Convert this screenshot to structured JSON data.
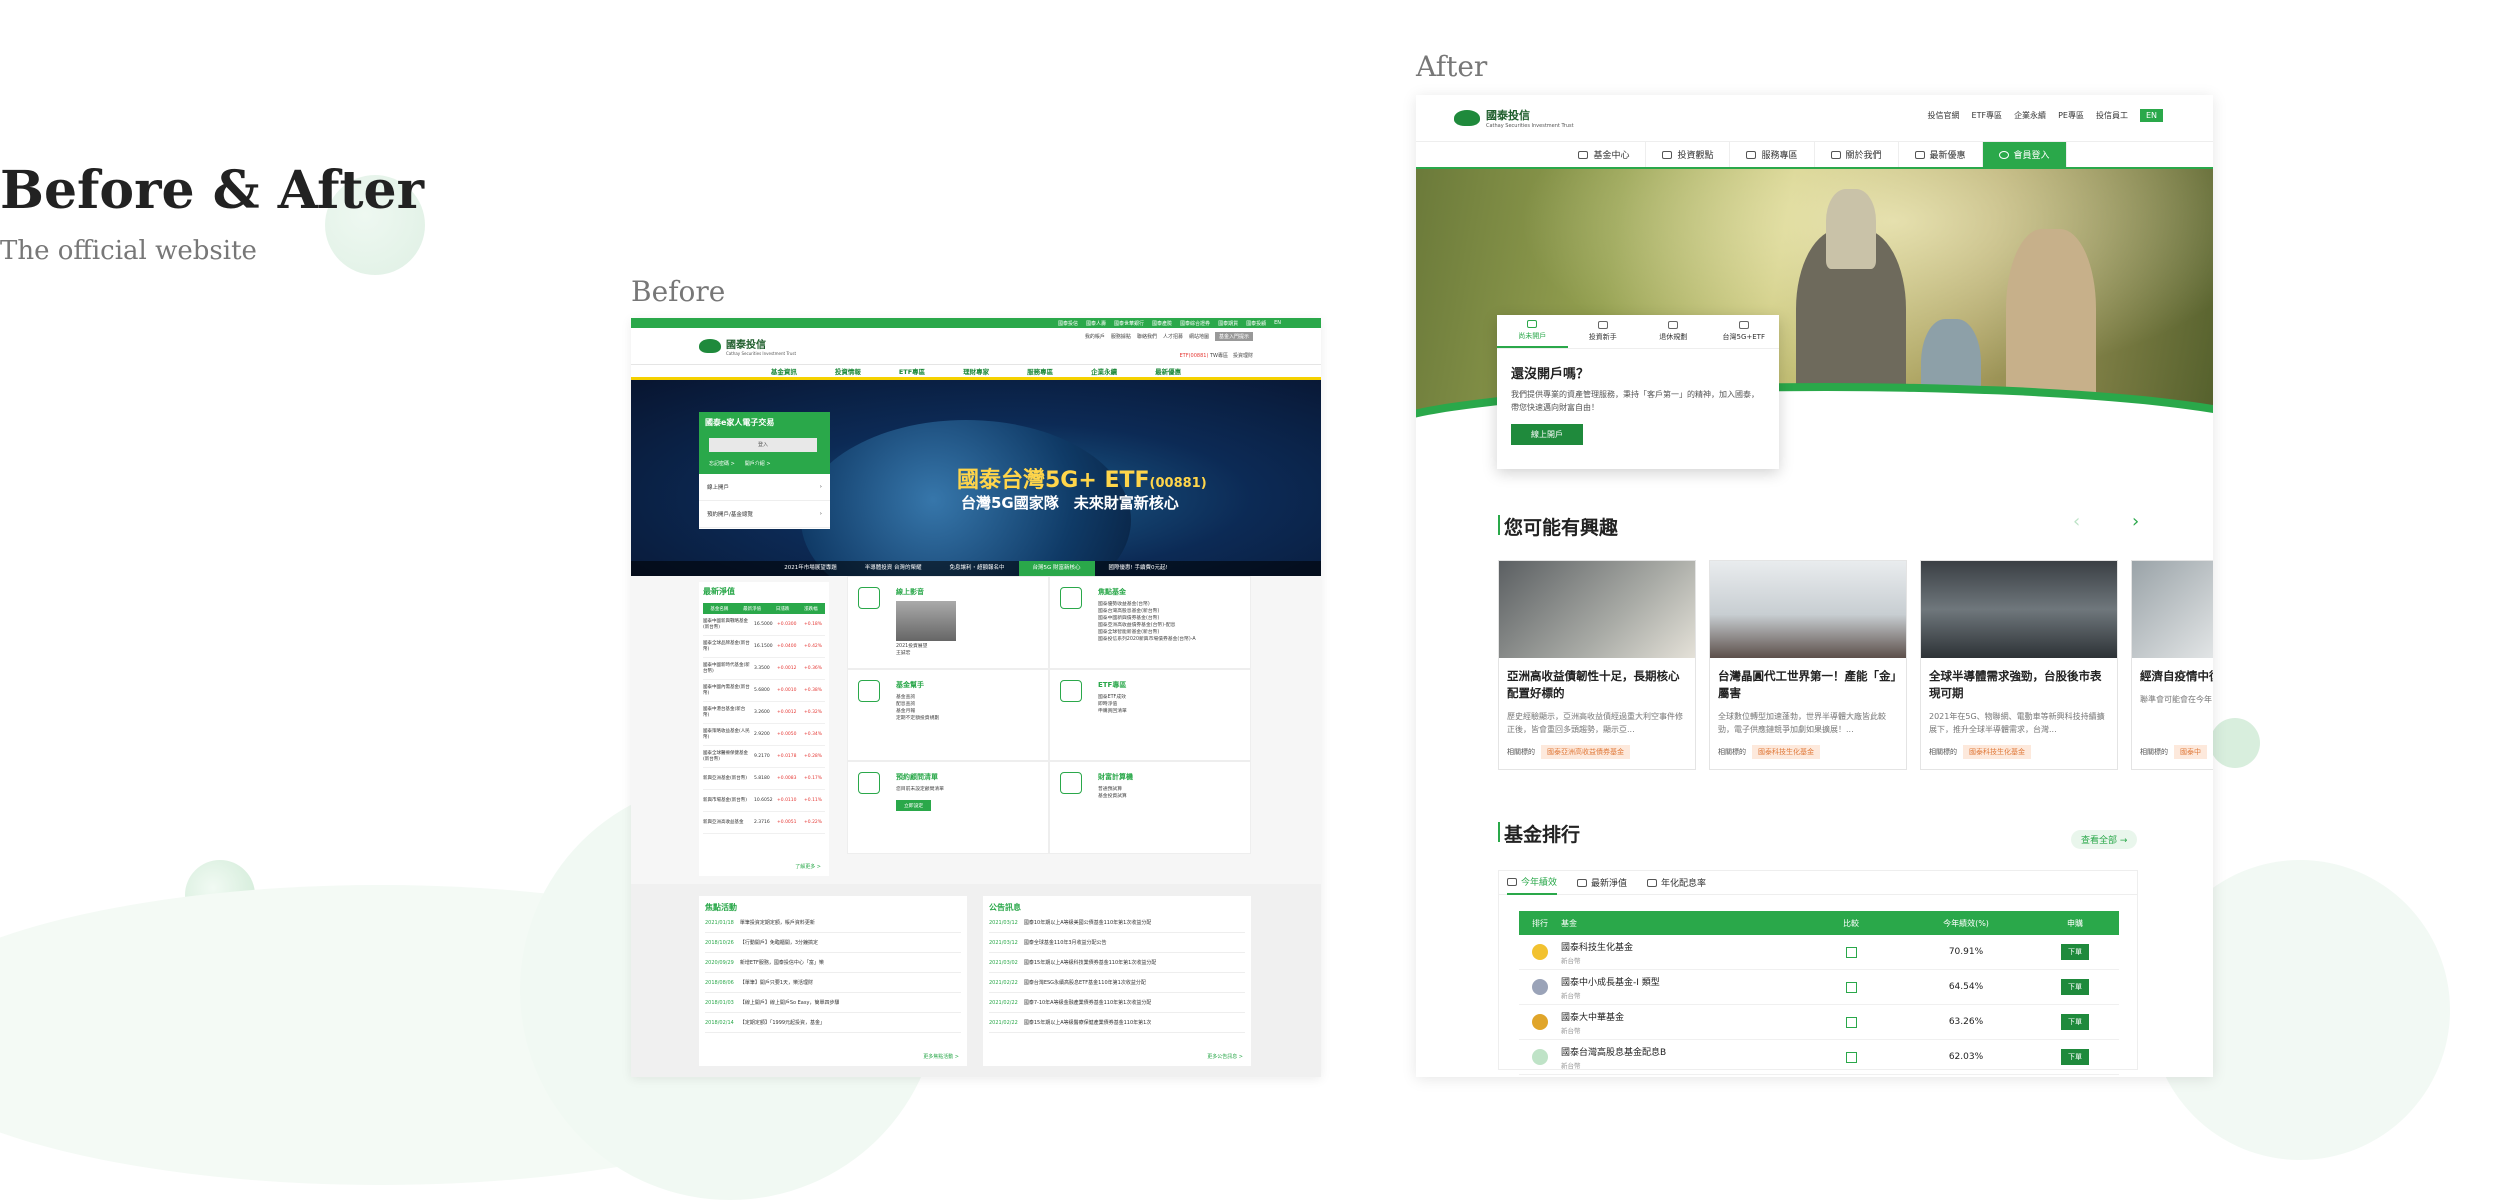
{
  "intro": {
    "title": "Before & After",
    "subtitle": "The official website"
  },
  "before_label": "Before",
  "after_label": "After",
  "colors": {
    "brand_green": "#2aa84a",
    "dark_green": "#1f8a3c",
    "accent_yellow": "#f5d100",
    "banner_navy": "#0c2a55"
  },
  "before": {
    "top_links": [
      "國泰投信",
      "國泰人壽",
      "國泰世華銀行",
      "國泰產險",
      "國泰綜合證券",
      "國泰期貨",
      "國泰投顧",
      "EN"
    ],
    "logo": {
      "name": "國泰投信",
      "sub": "Cathay Securities Investment Trust"
    },
    "util": {
      "links": [
        "我的帳戶",
        "服務據點",
        "聯絡我們",
        "人才招募",
        "網站地圖"
      ],
      "button": "基金入門提示"
    },
    "hot": {
      "prefix": "ETF(00881)",
      "items": "TW專區　投資理財"
    },
    "main_nav": [
      "基金資訊",
      "投資情報",
      "ETF專區",
      "理財專家",
      "服務專區",
      "企業永續",
      "最新優惠"
    ],
    "banner": {
      "title": "國泰台灣5G+ ETF",
      "code": "(00881)",
      "subtitle": "台灣5G國家隊　未來財富新核心"
    },
    "login": {
      "title": "國泰e家人電子交易",
      "button": "登入",
      "links": [
        "忘記密碼 >",
        "開戶介紹 >"
      ],
      "rows": [
        "線上開戶",
        "預約開戶/基金總覽"
      ]
    },
    "tabs": [
      {
        "label": "2021年市場展望專題",
        "active": false
      },
      {
        "label": "半導體投資 台灣的榮耀",
        "active": false
      },
      {
        "label": "免息讓利・超額報名中",
        "active": false
      },
      {
        "label": "台灣5G 財富新核心",
        "active": true
      },
      {
        "label": "國際優惠! 手續費0元起!",
        "active": false
      }
    ],
    "nav": {
      "title": "最新淨值",
      "head": [
        "基金名稱",
        "最新淨值",
        "日漲跌",
        "漲跌幅"
      ],
      "rows": [
        {
          "name": "國泰中國新興戰略基金(新台幣)",
          "value": "16.5000",
          "change": "+0.0300",
          "pct": "+0.18%"
        },
        {
          "name": "國泰全球品牌基金(新台幣)",
          "value": "16.1500",
          "change": "+0.0400",
          "pct": "+0.42%"
        },
        {
          "name": "國泰中國新時代基金(新台幣)",
          "value": "3.3500",
          "change": "+0.0012",
          "pct": "+0.36%"
        },
        {
          "name": "國泰中國內需基金(新台幣)",
          "value": "5.6800",
          "change": "+0.0010",
          "pct": "+0.38%"
        },
        {
          "name": "國泰中港台基金(新台幣)",
          "value": "3.2600",
          "change": "+0.0012",
          "pct": "+0.32%"
        },
        {
          "name": "國泰策略收益基金(人民幣)",
          "value": "2.9200",
          "change": "+0.0050",
          "pct": "+0.34%"
        },
        {
          "name": "國泰全球醫療保健基金(新台幣)",
          "value": "9.2170",
          "change": "+0.0178",
          "pct": "+0.28%"
        },
        {
          "name": "新興亞洲基金(新台幣)",
          "value": "5.8180",
          "change": "+0.0083",
          "pct": "+0.17%"
        },
        {
          "name": "新興市場基金(新台幣)",
          "value": "10.6052",
          "change": "+0.0110",
          "pct": "+0.11%"
        },
        {
          "name": "新興亞洲高收益基金",
          "value": "2.3716",
          "change": "+0.0051",
          "pct": "+0.22%"
        }
      ],
      "more": "了解更多 >"
    },
    "grid": [
      {
        "title": "線上影音",
        "items": [
          "2021投資展望",
          "王誠宏"
        ]
      },
      {
        "title": "焦點基金",
        "items": [
          "國泰優勢收益基金(台幣)",
          "國泰台灣高股息基金(新台幣)",
          "國泰中國新興債券基金(台幣)",
          "國泰亞洲高收益債券基金(台幣)-配息",
          "國泰全球智能新基金(新台幣)",
          "國泰投信系列2020新興市場債券基金(台幣)-A"
        ]
      },
      {
        "title": "基金幫手",
        "items": [
          "基金查詢",
          "配息查詢",
          "基金月報",
          "定期不定額投資規劃"
        ]
      },
      {
        "title": "ETF專區",
        "items": [
          "國泰ETF成效",
          "即時淨值",
          "申購買回清單"
        ]
      },
      {
        "title": "預約顧問清單",
        "items": [
          "您目前未設定顧問清單"
        ],
        "button": "立即設定"
      },
      {
        "title": "財富計算機",
        "items": [
          "普通預試算",
          "基金投資試算"
        ]
      }
    ],
    "events": {
      "title": "焦點活動",
      "rows": [
        {
          "date": "2021/01/18",
          "text": "單筆投資定期定額，帳戶資料更新"
        },
        {
          "date": "2018/10/26",
          "text": "【行動開戶】免臨櫃開，3分鐘搞定"
        },
        {
          "date": "2020/09/29",
          "text": "新增ETF服務，國泰投信中心「富」樂"
        },
        {
          "date": "2018/08/06",
          "text": "【單筆】開戶只要1天，樂活理財"
        },
        {
          "date": "2018/01/03",
          "text": "【線上開戶】線上開戶So Easy，簡單四步驟"
        },
        {
          "date": "2018/02/14",
          "text": "【定期定額】「1999元起投資，基金」"
        }
      ],
      "more": "更多焦點活動 >"
    },
    "notices": {
      "title": "公告訊息",
      "rows": [
        {
          "date": "2021/03/12",
          "text": "國泰10年期以上A等級美國公債基金110年第1次收益分配"
        },
        {
          "date": "2021/03/12",
          "text": "國泰全球基金110年3月收益分配公告"
        },
        {
          "date": "2021/03/02",
          "text": "國泰15年期以上A等級科技業債券基金110年第1次收益分配"
        },
        {
          "date": "2021/02/22",
          "text": "國泰台灣ESG永續高股息ETF基金110年第1次收益分配"
        },
        {
          "date": "2021/02/22",
          "text": "國泰7-10年A等級金融產業債券基金110年第1次收益分配"
        },
        {
          "date": "2021/02/22",
          "text": "國泰15年期以上A等級醫療保健產業債券基金110年第1次"
        }
      ],
      "more": "更多公告訊息 >"
    }
  },
  "after": {
    "logo": {
      "name": "國泰投信",
      "sub": "Cathay Securities Investment Trust"
    },
    "util": [
      "投信官網",
      "ETF專區",
      "企業永續",
      "PE專區",
      "投信員工"
    ],
    "lang": "EN",
    "nav": [
      {
        "label": "基金中心",
        "icon": "coins-icon"
      },
      {
        "label": "投資觀點",
        "icon": "trend-icon"
      },
      {
        "label": "服務專區",
        "icon": "anchor-icon"
      },
      {
        "label": "關於我們",
        "icon": "chat-icon"
      },
      {
        "label": "最新優惠",
        "icon": "gift-icon"
      },
      {
        "label": "會員登入",
        "icon": "user-icon"
      }
    ],
    "card": {
      "tabs": [
        {
          "label": "尚未開戶",
          "icon": "account-icon",
          "active": true
        },
        {
          "label": "投資新手",
          "icon": "newbie-icon",
          "active": false
        },
        {
          "label": "退休規劃",
          "icon": "retire-icon",
          "active": false
        },
        {
          "label": "台灣5G+ETF",
          "icon": "etf-icon",
          "active": false
        }
      ],
      "title": "還沒開戶嗎？",
      "desc": "我們提供專業的資產管理服務，秉持「客戶第一」的精神，加入國泰，帶您快速邁向財富自由！",
      "button": "線上開戶"
    },
    "interest": {
      "title": "您可能有興趣",
      "cards": [
        {
          "title": "亞洲高收益債韌性十足，長期核心配置好標的",
          "desc": "歷史經驗顯示，亞洲高收益債經過重大利空事件修正後，皆會重回多頭趨勢，顯示亞...",
          "tag_key": "相關標的",
          "tag": "國泰亞洲高收益債券基金"
        },
        {
          "title": "台灣晶圓代工世界第一！產能「金」屬害",
          "desc": "全球數位轉型加速蓬勃，世界半導體大廠皆此較勁，電子供應鏈競爭加劇如果擴展！...",
          "tag_key": "相關標的",
          "tag": "國泰科技生化基金"
        },
        {
          "title": "全球半導體需求強勁，台股後市表現可期",
          "desc": "2021年在5G、物聯網、電動車等新興科技持續擴展下，推升全球半導體需求，台灣...",
          "tag_key": "相關標的",
          "tag": "國泰科技生化基金"
        },
        {
          "title": "經濟自疫情中復甦 益債漲升動能",
          "desc": "聯準會可能會在今年 產，部分委員對於",
          "tag_key": "相關標的",
          "tag": "國泰中"
        }
      ]
    },
    "ranking": {
      "title": "基金排行",
      "view_all": "查看全部",
      "tabs": [
        {
          "label": "今年績效",
          "icon": "trend-icon",
          "active": true
        },
        {
          "label": "最新淨值",
          "icon": "dollar-icon",
          "active": false
        },
        {
          "label": "年化配息率",
          "icon": "doc-icon",
          "active": false
        }
      ],
      "head": [
        "排行",
        "基金",
        "比較",
        "今年績效(%)",
        "申購"
      ],
      "rows": [
        {
          "name": "國泰科技生化基金",
          "sub": "新台幣",
          "perf": "70.91%",
          "buy": "下單"
        },
        {
          "name": "國泰中小成長基金-I 類型",
          "sub": "新台幣",
          "perf": "64.54%",
          "buy": "下單"
        },
        {
          "name": "國泰大中華基金",
          "sub": "新台幣",
          "perf": "63.26%",
          "buy": "下單"
        },
        {
          "name": "國泰台灣高股息基金配息B",
          "sub": "新台幣",
          "perf": "62.03%",
          "buy": "下單"
        }
      ]
    }
  }
}
